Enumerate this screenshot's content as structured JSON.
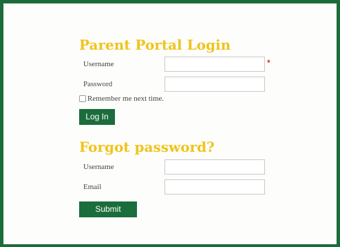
{
  "login": {
    "heading": "Parent Portal Login",
    "username_label": "Username",
    "username_value": "",
    "required_marker": "*",
    "password_label": "Password",
    "password_value": "",
    "remember_label": "Remember me next time.",
    "remember_checked": false,
    "login_button": "Log In"
  },
  "forgot": {
    "heading": "Forgot password?",
    "username_label": "Username",
    "username_value": "",
    "email_label": "Email",
    "email_value": "",
    "submit_button": "Submit"
  },
  "colors": {
    "frame_border": "#1c6b3a",
    "heading": "#f0c41b",
    "button_bg": "#1b6d3b",
    "required": "#e0342b"
  }
}
